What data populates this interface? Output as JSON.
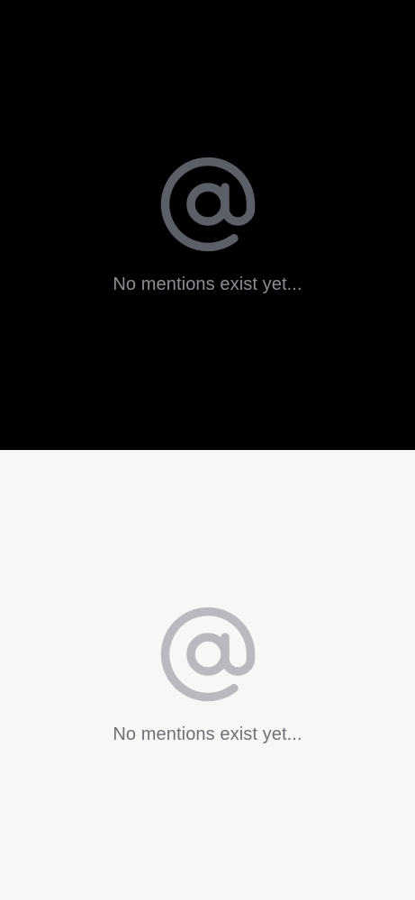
{
  "dark_screen": {
    "empty_message": "No mentions exist yet...",
    "icon": "at-sign-icon",
    "colors": {
      "background": "#000000",
      "icon": "#5b5f68",
      "text": "#8b8e94"
    }
  },
  "light_screen": {
    "empty_message": "No mentions exist yet...",
    "icon": "at-sign-icon",
    "colors": {
      "background": "#f7f7f7",
      "icon": "#b8babf",
      "text": "#6e7076"
    }
  }
}
